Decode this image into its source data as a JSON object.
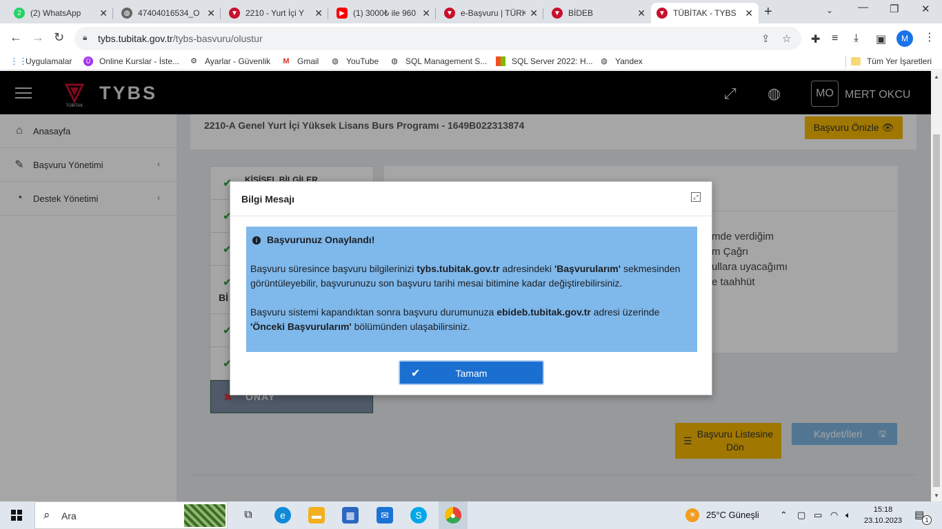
{
  "browser": {
    "tabs": [
      {
        "label": "(2) WhatsApp",
        "icon": "whatsapp-icon",
        "color": "#25d366",
        "glyph": "2"
      },
      {
        "label": "47404016534_O",
        "icon": "globe-icon",
        "color": "#555555",
        "glyph": "◍"
      },
      {
        "label": "2210 - Yurt İçi Y",
        "icon": "tubitak-icon",
        "color": "#c8102e",
        "glyph": "▼"
      },
      {
        "label": "(1) 3000₺ ile 960",
        "icon": "youtube-icon",
        "color": "#ff0000",
        "glyph": "▶"
      },
      {
        "label": "e-Başvuru | TÜRK",
        "icon": "tubitak-icon",
        "color": "#c8102e",
        "glyph": "▼"
      },
      {
        "label": "BİDEB",
        "icon": "tubitak-icon",
        "color": "#c8102e",
        "glyph": "▼"
      },
      {
        "label": "TÜBİTAK - TYBS",
        "icon": "tubitak-icon",
        "color": "#c8102e",
        "glyph": "▼",
        "active": true
      }
    ],
    "url_host": "tybs.tubitak.gov.tr",
    "url_path": "/tybs-basvuru/olustur",
    "profile_initial": "M",
    "bookmarks": [
      {
        "label": "Uygulamalar",
        "icon": "apps-grid-icon"
      },
      {
        "label": "Online Kurslar - İste...",
        "icon": "udemy-icon"
      },
      {
        "label": "Ayarlar - Güvenlik",
        "icon": "gear-icon"
      },
      {
        "label": "Gmail",
        "icon": "gmail-icon"
      },
      {
        "label": "YouTube",
        "icon": "globe-icon"
      },
      {
        "label": "SQL Management S...",
        "icon": "globe-icon"
      },
      {
        "label": "SQL Server 2022: H...",
        "icon": "microsoft-icon"
      },
      {
        "label": "Yandex",
        "icon": "globe-icon"
      }
    ],
    "all_bookmarks": "Tüm Yer İşaretleri"
  },
  "app": {
    "logo_text": "TYBS",
    "logo_sub": "TÜBİTAK",
    "user_initials": "MO",
    "user_name": "MERT OKCU",
    "sidebar": [
      {
        "label": "Anasayfa",
        "icon": "home-icon"
      },
      {
        "label": "Başvuru Yönetimi",
        "icon": "pen-icon"
      },
      {
        "label": "Destek Yönetimi",
        "icon": "pie-chart-icon"
      }
    ],
    "program_title": "2210-A Genel Yurt İçi Yüksek Lisans Burs Programı - 1649B022313874",
    "preview_button": "Başvuru Önizle",
    "step_first": "KİŞİSEL BİLGİLER",
    "step_partial": "Bİ",
    "step_last": "ONAY",
    "right_text": [
      "mde verdiğim",
      "m Çağrı",
      "ullara uyacağımı",
      "e taahhüt"
    ],
    "back_button": "Başvuru Listesine Dön",
    "save_button": "Kaydet/İleri"
  },
  "modal": {
    "title": "Bilgi Mesajı",
    "alert_heading": "Başvurunuz Onaylandı!",
    "p1_a": "Başvuru süresince başvuru bilgilerinizi ",
    "p1_b": "tybs.tubitak.gov.tr",
    "p1_c": " adresindeki ",
    "p1_d": "'Başvurularım'",
    "p1_e": " sekmesinden görüntüleyebilir, başvurunuzu son başvuru tarihi mesai bitimine kadar değiştirebilirsiniz.",
    "p2_a": "Başvuru sistemi kapandıktan sonra başvuru durumunuza ",
    "p2_b": "ebideb.tubitak.gov.tr",
    "p2_c": " adresi üzerinde ",
    "p2_d": "'Önceki Başvurularım'",
    "p2_e": " bölümünden ulaşabilirsiniz.",
    "ok_button": "Tamam"
  },
  "taskbar": {
    "search_placeholder": "Ara",
    "weather": "25°C  Güneşli",
    "time": "15:18",
    "date": "23.10.2023",
    "notification_count": "1"
  }
}
